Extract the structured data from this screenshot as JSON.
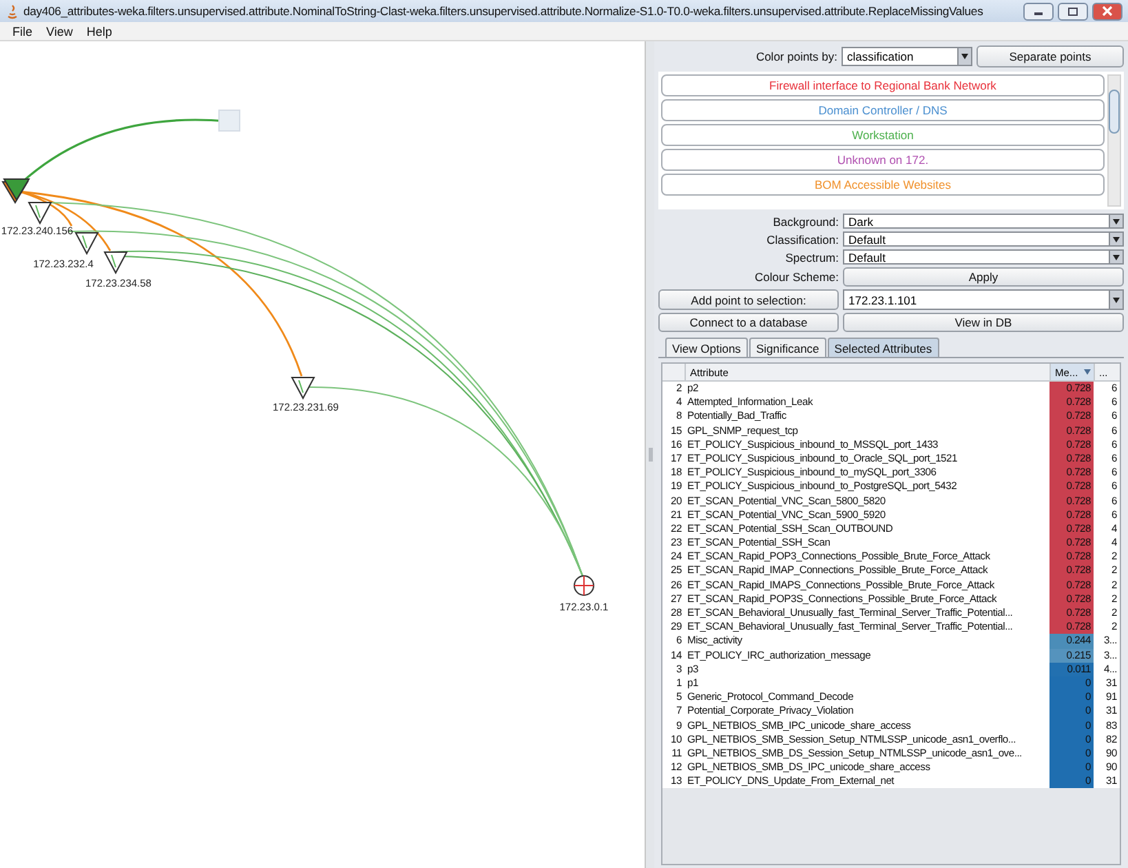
{
  "window": {
    "title": "day406_attributes-weka.filters.unsupervised.attribute.NominalToString-Clast-weka.filters.unsupervised.attribute.Normalize-S1.0-T0.0-weka.filters.unsupervised.attribute.ReplaceMissingValues"
  },
  "menu": [
    "File",
    "View",
    "Help"
  ],
  "graph": {
    "nodes": [
      {
        "kind": "triangle",
        "label": "172.23.240.156"
      },
      {
        "kind": "triangle",
        "label": "172.23.232.4"
      },
      {
        "kind": "triangle",
        "label": "172.23.234.58"
      },
      {
        "kind": "triangle",
        "label": "172.23.231.69"
      },
      {
        "kind": "target",
        "label": "172.23.0.1"
      }
    ]
  },
  "color_points": {
    "label": "Color points by:",
    "value": "classification",
    "button": "Separate points"
  },
  "legend": [
    {
      "label": "Firewall interface to Regional Bank Network",
      "color": "#e8303a"
    },
    {
      "label": "Domain Controller / DNS",
      "color": "#4a8fd0"
    },
    {
      "label": "Workstation",
      "color": "#4cb04c"
    },
    {
      "label": "Unknown on 172.",
      "color": "#b050b0"
    },
    {
      "label": "BOM Accessible Websites",
      "color": "#f0902a"
    }
  ],
  "settings": [
    {
      "kind": "select",
      "label": "Background:",
      "value": "Dark"
    },
    {
      "kind": "select",
      "label": "Classification:",
      "value": "Default"
    },
    {
      "kind": "select",
      "label": "Spectrum:",
      "value": "Default"
    },
    {
      "kind": "button",
      "label": "Colour Scheme:",
      "value": "Apply"
    }
  ],
  "add_point": {
    "button": "Add point to selection:",
    "value": "172.23.1.101"
  },
  "actions": [
    "Connect to a database",
    "View in DB"
  ],
  "tabs": [
    {
      "label": "View Options",
      "selected": false
    },
    {
      "label": "Significance",
      "selected": false
    },
    {
      "label": "Selected Attributes",
      "selected": true
    }
  ],
  "table": {
    "columns": [
      "Attribute",
      "Me...",
      "..."
    ],
    "rows": [
      {
        "index": "2",
        "attribute": "p2",
        "value": "0.728",
        "count": "6",
        "color": "#c9404f"
      },
      {
        "index": "4",
        "attribute": "Attempted_Information_Leak",
        "value": "0.728",
        "count": "6",
        "color": "#c9404f"
      },
      {
        "index": "8",
        "attribute": "Potentially_Bad_Traffic",
        "value": "0.728",
        "count": "6",
        "color": "#c9404f"
      },
      {
        "index": "15",
        "attribute": "GPL_SNMP_request_tcp",
        "value": "0.728",
        "count": "6",
        "color": "#c9404f"
      },
      {
        "index": "16",
        "attribute": "ET_POLICY_Suspicious_inbound_to_MSSQL_port_1433",
        "value": "0.728",
        "count": "6",
        "color": "#c9404f"
      },
      {
        "index": "17",
        "attribute": "ET_POLICY_Suspicious_inbound_to_Oracle_SQL_port_1521",
        "value": "0.728",
        "count": "6",
        "color": "#c9404f"
      },
      {
        "index": "18",
        "attribute": "ET_POLICY_Suspicious_inbound_to_mySQL_port_3306",
        "value": "0.728",
        "count": "6",
        "color": "#c9404f"
      },
      {
        "index": "19",
        "attribute": "ET_POLICY_Suspicious_inbound_to_PostgreSQL_port_5432",
        "value": "0.728",
        "count": "6",
        "color": "#c9404f"
      },
      {
        "index": "20",
        "attribute": "ET_SCAN_Potential_VNC_Scan_5800_5820",
        "value": "0.728",
        "count": "6",
        "color": "#c9404f"
      },
      {
        "index": "21",
        "attribute": "ET_SCAN_Potential_VNC_Scan_5900_5920",
        "value": "0.728",
        "count": "6",
        "color": "#c9404f"
      },
      {
        "index": "22",
        "attribute": "ET_SCAN_Potential_SSH_Scan_OUTBOUND",
        "value": "0.728",
        "count": "4",
        "color": "#c9404f"
      },
      {
        "index": "23",
        "attribute": "ET_SCAN_Potential_SSH_Scan",
        "value": "0.728",
        "count": "4",
        "color": "#c9404f"
      },
      {
        "index": "24",
        "attribute": "ET_SCAN_Rapid_POP3_Connections_Possible_Brute_Force_Attack",
        "value": "0.728",
        "count": "2",
        "color": "#c9404f"
      },
      {
        "index": "25",
        "attribute": "ET_SCAN_Rapid_IMAP_Connections_Possible_Brute_Force_Attack",
        "value": "0.728",
        "count": "2",
        "color": "#c9404f"
      },
      {
        "index": "26",
        "attribute": "ET_SCAN_Rapid_IMAPS_Connections_Possible_Brute_Force_Attack",
        "value": "0.728",
        "count": "2",
        "color": "#c9404f"
      },
      {
        "index": "27",
        "attribute": "ET_SCAN_Rapid_POP3S_Connections_Possible_Brute_Force_Attack",
        "value": "0.728",
        "count": "2",
        "color": "#c9404f"
      },
      {
        "index": "28",
        "attribute": "ET_SCAN_Behavioral_Unusually_fast_Terminal_Server_Traffic_Potential...",
        "value": "0.728",
        "count": "2",
        "color": "#c9404f"
      },
      {
        "index": "29",
        "attribute": "ET_SCAN_Behavioral_Unusually_fast_Terminal_Server_Traffic_Potential...",
        "value": "0.728",
        "count": "2",
        "color": "#c9404f"
      },
      {
        "index": "6",
        "attribute": "Misc_activity",
        "value": "0.244",
        "count": "3...",
        "color": "#4b8db8"
      },
      {
        "index": "14",
        "attribute": "ET_POLICY_IRC_authorization_message",
        "value": "0.215",
        "count": "3...",
        "color": "#5593bd"
      },
      {
        "index": "3",
        "attribute": "p3",
        "value": "0.011",
        "count": "4...",
        "color": "#2270b0"
      },
      {
        "index": "1",
        "attribute": "p1",
        "value": "0",
        "count": "31",
        "color": "#1f6eb0"
      },
      {
        "index": "5",
        "attribute": "Generic_Protocol_Command_Decode",
        "value": "0",
        "count": "91",
        "color": "#1f6eb0"
      },
      {
        "index": "7",
        "attribute": "Potential_Corporate_Privacy_Violation",
        "value": "0",
        "count": "31",
        "color": "#1f6eb0"
      },
      {
        "index": "9",
        "attribute": "GPL_NETBIOS_SMB_IPC_unicode_share_access",
        "value": "0",
        "count": "83",
        "color": "#1f6eb0"
      },
      {
        "index": "10",
        "attribute": "GPL_NETBIOS_SMB_Session_Setup_NTMLSSP_unicode_asn1_overflo...",
        "value": "0",
        "count": "82",
        "color": "#1f6eb0"
      },
      {
        "index": "11",
        "attribute": "GPL_NETBIOS_SMB_DS_Session_Setup_NTMLSSP_unicode_asn1_ove...",
        "value": "0",
        "count": "90",
        "color": "#1f6eb0"
      },
      {
        "index": "12",
        "attribute": "GPL_NETBIOS_SMB_DS_IPC_unicode_share_access",
        "value": "0",
        "count": "90",
        "color": "#1f6eb0"
      },
      {
        "index": "13",
        "attribute": "ET_POLICY_DNS_Update_From_External_net",
        "value": "0",
        "count": "31",
        "color": "#1f6eb0"
      }
    ]
  }
}
